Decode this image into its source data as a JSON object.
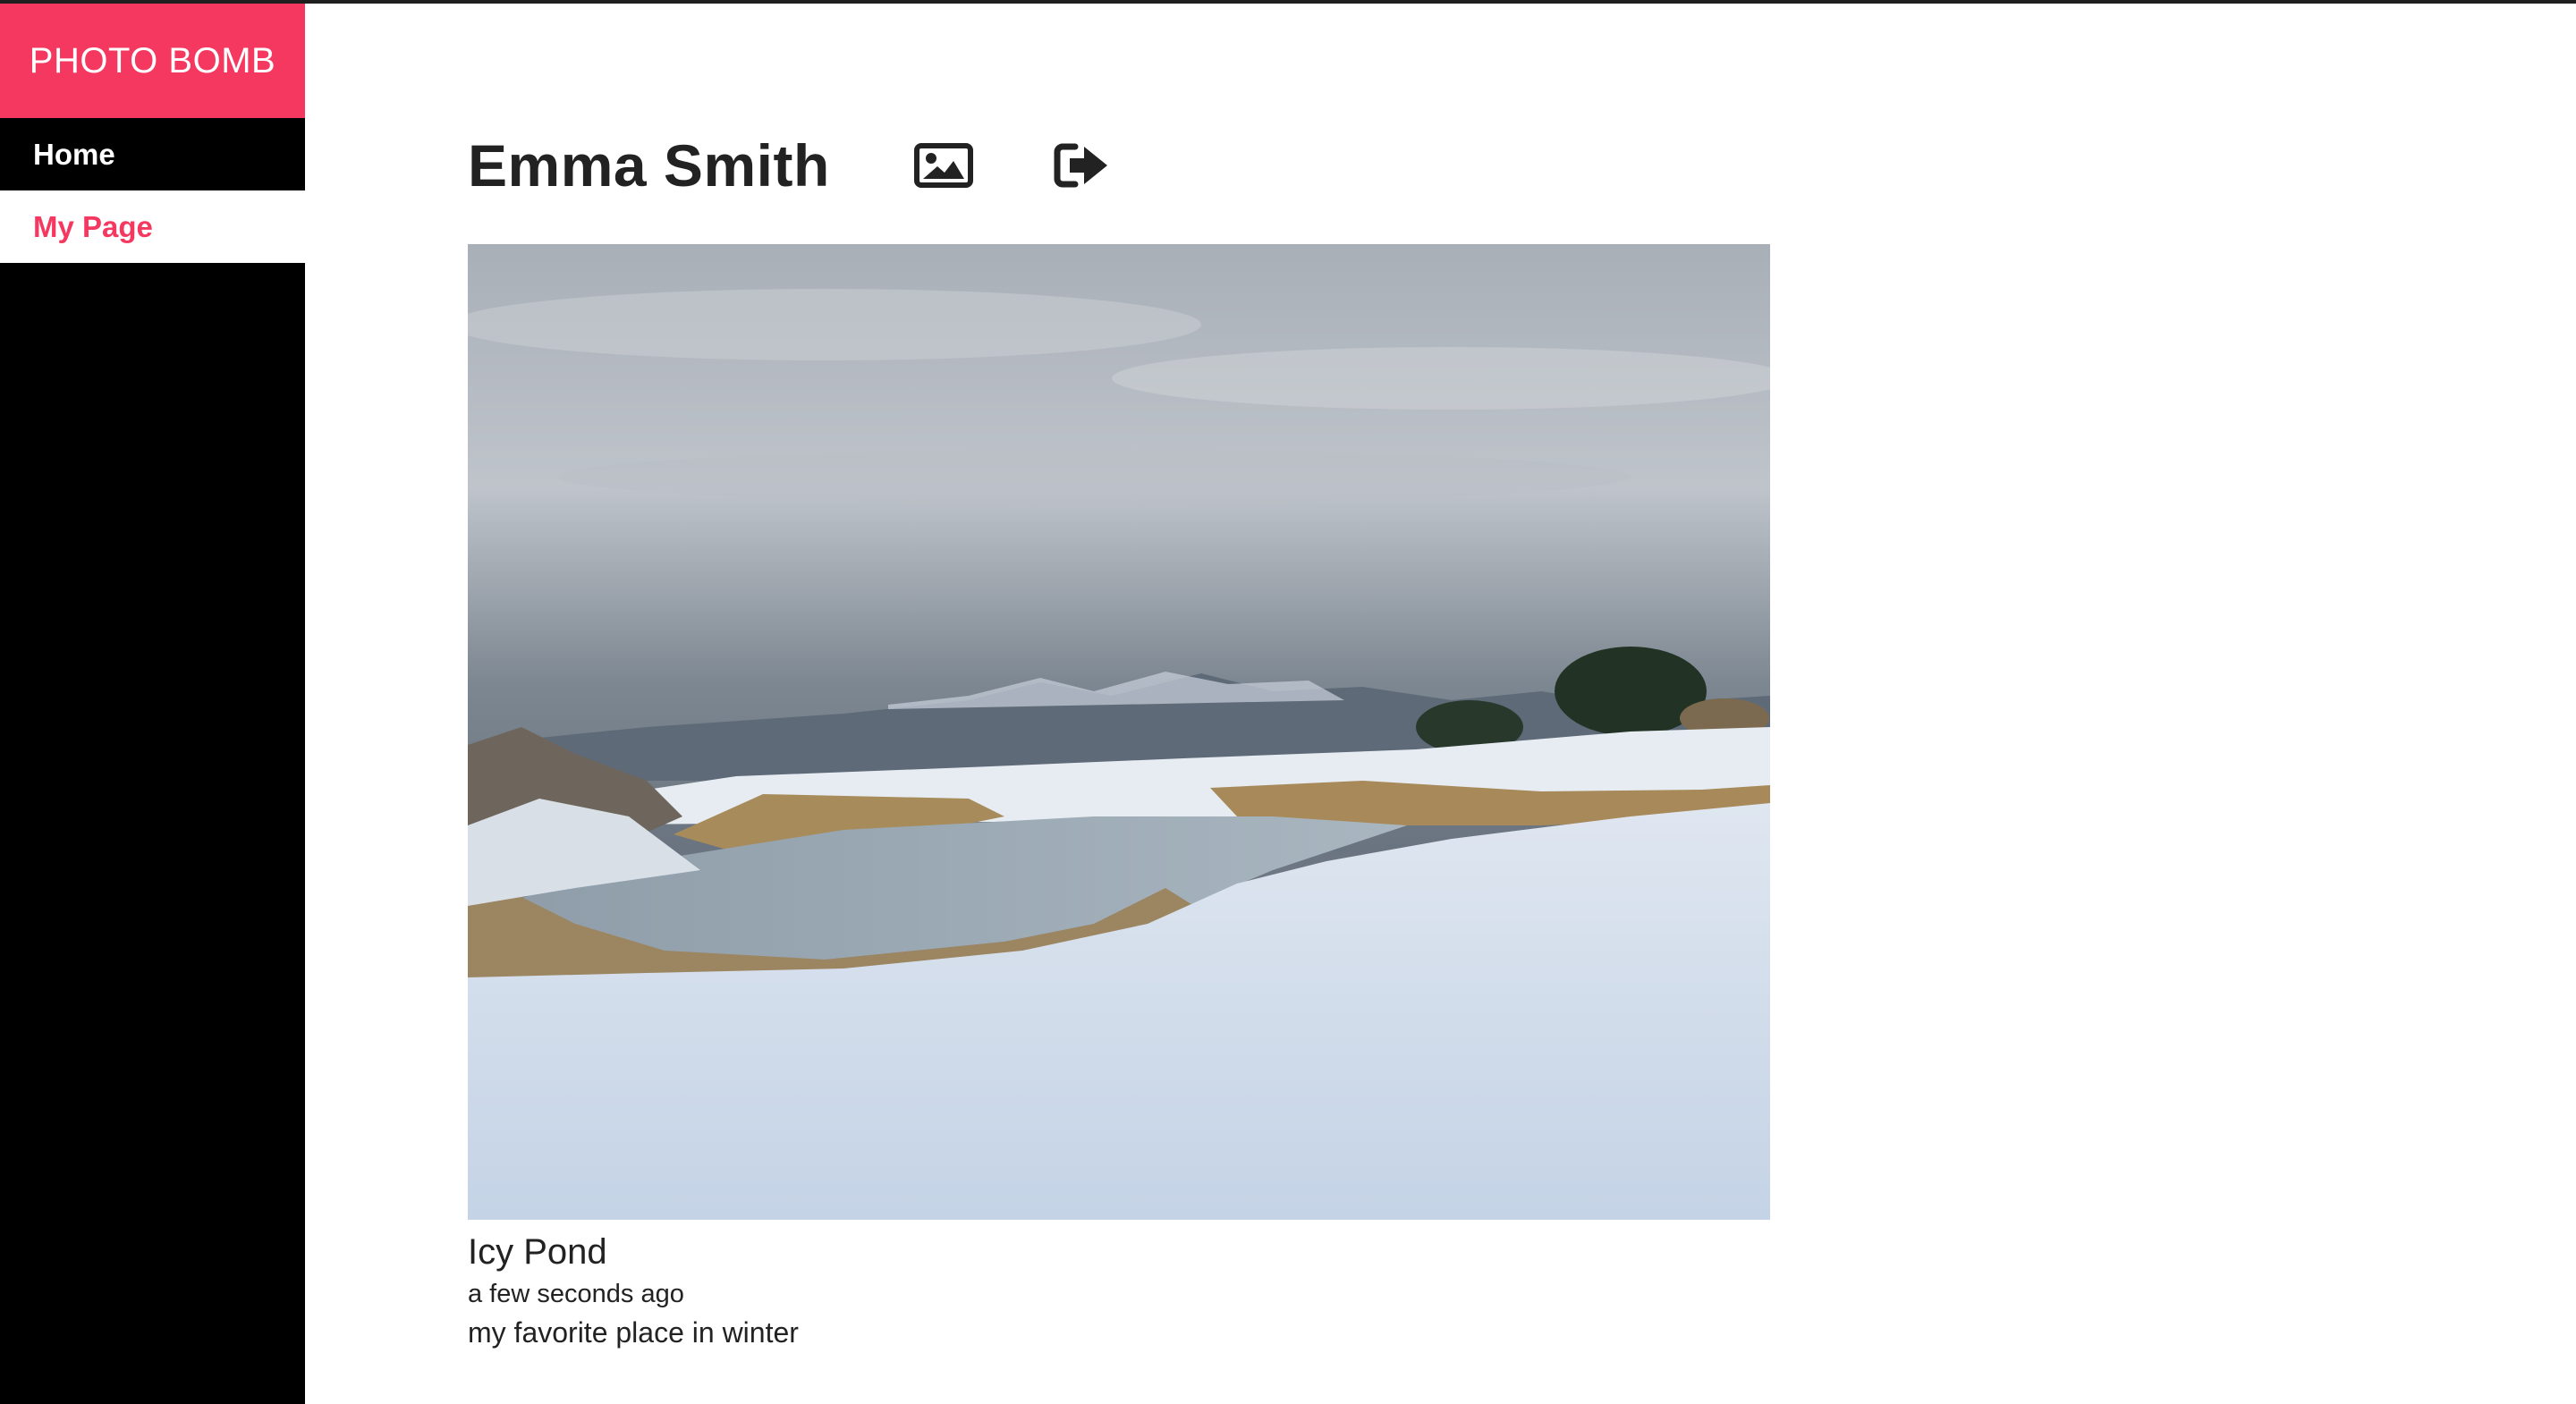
{
  "app": {
    "brand": "PHOTO BOMB",
    "accent_color": "#f5385f"
  },
  "sidebar": {
    "items": [
      {
        "label": "Home",
        "active": false
      },
      {
        "label": "My Page",
        "active": true
      }
    ]
  },
  "header": {
    "user_name": "Emma Smith",
    "icons": [
      "image-gallery-icon",
      "sign-out-icon"
    ]
  },
  "post": {
    "title": "Icy Pond",
    "timestamp": "a few seconds ago",
    "description": "my favorite place in winter"
  }
}
